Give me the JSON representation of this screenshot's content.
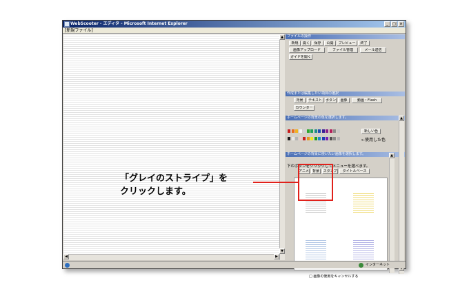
{
  "window": {
    "title": "WebScooter - エディタ - Microsoft Internet Explorer",
    "file_label": "[新規ファイル]",
    "buttons": [
      "_",
      "□",
      "×"
    ]
  },
  "panel": {
    "file_ops": {
      "header": "ファイルの操作",
      "row1": [
        "新規",
        "開く",
        "保存",
        "公開",
        "プレビュー",
        "終了"
      ],
      "row2": [
        "画像アップロード",
        "ファイル管理",
        "メール送信"
      ],
      "row3": [
        "ガイドを開く"
      ]
    },
    "insert": {
      "header": "作成または編集したい項目の選択",
      "row1": [
        "背景",
        "テキスト",
        "ボタン",
        "画像",
        "動画・Flash"
      ],
      "row2": [
        "カウンター"
      ]
    },
    "bg_color": {
      "header": "ホームページの背景の色を選択します。",
      "new_color_button": "新しい色",
      "used_colors_label": "←使用した色",
      "swatches_top": [
        "#c81e1e",
        "#e86b1e",
        "#f2b21e",
        "#f5f5f5",
        "#d2d2d2",
        "#2ea82e",
        "#1ea05a",
        "#1e8a8a",
        "#1e4bb4",
        "#3c1e96",
        "#8a1e8a",
        "#b41e5a",
        "#8c8c8c",
        "#c8c8c8"
      ],
      "swatches_bottom": [
        "#1e1e1e",
        "#e8e8e8",
        "#b4b4b4",
        "#f0c8c8",
        "#c81e1e",
        "#e8961e",
        "#f0e61e",
        "#1e9a1e",
        "#1e8ac8",
        "#1e3cb4",
        "#781eb4",
        "#505050",
        "#8c8c8c",
        "#b4b4b4"
      ]
    },
    "bg_image": {
      "header": "ホームページの背景に使いたい画像を選択します。",
      "instruction": "下のボタンをクリックしてメニューを選べます。",
      "tabs": [
        "アニメ",
        "背景",
        "スタンプ",
        "タイトルベース"
      ],
      "thumbnails": [
        {
          "name": "gray-stripe",
          "color": "#c8c8c8"
        },
        {
          "name": "yellow-stripe",
          "color": "#f0dc78"
        },
        {
          "name": "blue-stripe",
          "color": "#b4c8e6"
        },
        {
          "name": "purple-stripe",
          "color": "#b4b4e6"
        }
      ],
      "checkbox_label": "□ 画像の使用をキャンセルする"
    }
  },
  "status": {
    "zone": "インターネット"
  },
  "callout": {
    "line1": "「グレイのストライプ」を",
    "line2": "クリックします。"
  }
}
